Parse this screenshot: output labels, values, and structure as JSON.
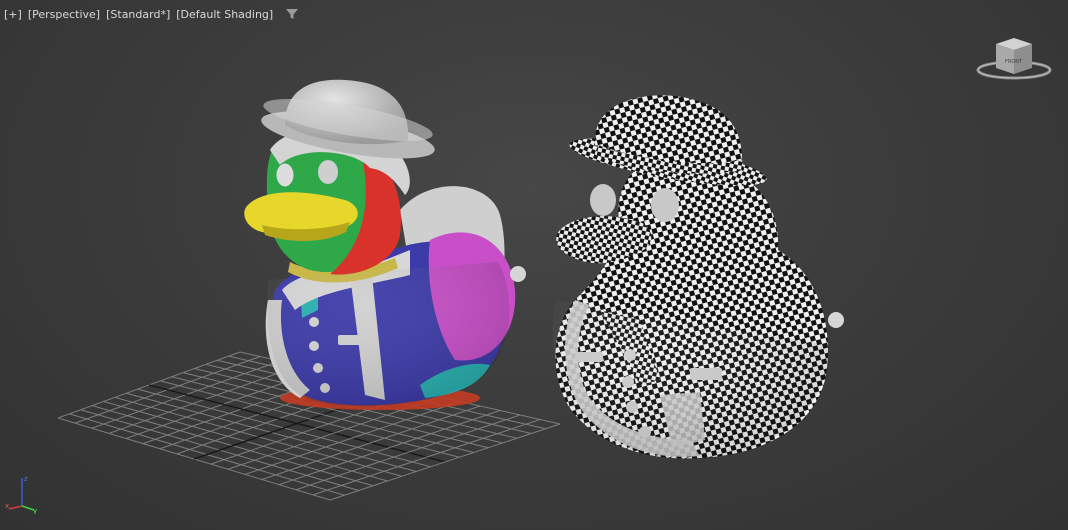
{
  "viewport": {
    "labels": [
      {
        "id": "menu",
        "text": "[+]"
      },
      {
        "id": "view",
        "text": "[Perspective]"
      },
      {
        "id": "shader",
        "text": "[Standard*]"
      },
      {
        "id": "shading",
        "text": "[Default Shading]"
      }
    ],
    "filter_icon": "funnel-icon",
    "viewcube_face": "FRONT",
    "axis_labels": {
      "z": "z",
      "x": "x",
      "y": "y"
    }
  },
  "scene": {
    "objects": [
      "duck-colored-id",
      "duck-checker-uv"
    ],
    "grid": "home-grid"
  },
  "colors": {
    "background": "#3b3b3b",
    "label_text": "#d8d8d8",
    "grid_line": "#8a8a8a",
    "duck_green": "#2fa84a",
    "duck_red": "#d8322a",
    "duck_blue": "#3c3aa8",
    "duck_magenta": "#c84fc8",
    "duck_beak": "#e6d72a",
    "duck_teal": "#28b0b0",
    "duck_white": "#d0d0d0"
  }
}
